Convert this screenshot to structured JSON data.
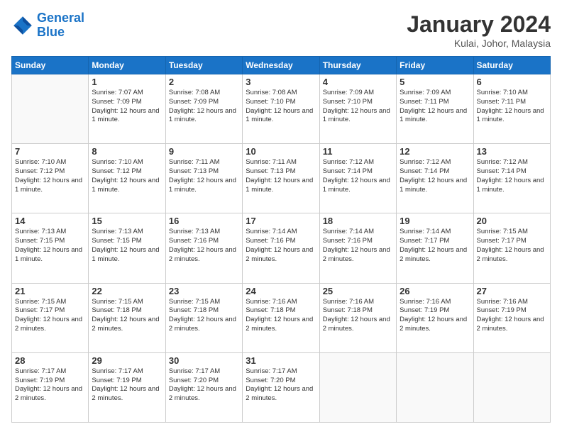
{
  "header": {
    "logo_line1": "General",
    "logo_line2": "Blue",
    "month": "January 2024",
    "location": "Kulai, Johor, Malaysia"
  },
  "weekdays": [
    "Sunday",
    "Monday",
    "Tuesday",
    "Wednesday",
    "Thursday",
    "Friday",
    "Saturday"
  ],
  "weeks": [
    [
      {
        "day": "",
        "sunrise": "",
        "sunset": "",
        "daylight": ""
      },
      {
        "day": "1",
        "sunrise": "7:07 AM",
        "sunset": "7:09 PM",
        "daylight": "12 hours and 1 minute."
      },
      {
        "day": "2",
        "sunrise": "7:08 AM",
        "sunset": "7:09 PM",
        "daylight": "12 hours and 1 minute."
      },
      {
        "day": "3",
        "sunrise": "7:08 AM",
        "sunset": "7:10 PM",
        "daylight": "12 hours and 1 minute."
      },
      {
        "day": "4",
        "sunrise": "7:09 AM",
        "sunset": "7:10 PM",
        "daylight": "12 hours and 1 minute."
      },
      {
        "day": "5",
        "sunrise": "7:09 AM",
        "sunset": "7:11 PM",
        "daylight": "12 hours and 1 minute."
      },
      {
        "day": "6",
        "sunrise": "7:10 AM",
        "sunset": "7:11 PM",
        "daylight": "12 hours and 1 minute."
      }
    ],
    [
      {
        "day": "7",
        "sunrise": "7:10 AM",
        "sunset": "7:12 PM",
        "daylight": "12 hours and 1 minute."
      },
      {
        "day": "8",
        "sunrise": "7:10 AM",
        "sunset": "7:12 PM",
        "daylight": "12 hours and 1 minute."
      },
      {
        "day": "9",
        "sunrise": "7:11 AM",
        "sunset": "7:13 PM",
        "daylight": "12 hours and 1 minute."
      },
      {
        "day": "10",
        "sunrise": "7:11 AM",
        "sunset": "7:13 PM",
        "daylight": "12 hours and 1 minute."
      },
      {
        "day": "11",
        "sunrise": "7:12 AM",
        "sunset": "7:14 PM",
        "daylight": "12 hours and 1 minute."
      },
      {
        "day": "12",
        "sunrise": "7:12 AM",
        "sunset": "7:14 PM",
        "daylight": "12 hours and 1 minute."
      },
      {
        "day": "13",
        "sunrise": "7:12 AM",
        "sunset": "7:14 PM",
        "daylight": "12 hours and 1 minute."
      }
    ],
    [
      {
        "day": "14",
        "sunrise": "7:13 AM",
        "sunset": "7:15 PM",
        "daylight": "12 hours and 1 minute."
      },
      {
        "day": "15",
        "sunrise": "7:13 AM",
        "sunset": "7:15 PM",
        "daylight": "12 hours and 1 minute."
      },
      {
        "day": "16",
        "sunrise": "7:13 AM",
        "sunset": "7:16 PM",
        "daylight": "12 hours and 2 minutes."
      },
      {
        "day": "17",
        "sunrise": "7:14 AM",
        "sunset": "7:16 PM",
        "daylight": "12 hours and 2 minutes."
      },
      {
        "day": "18",
        "sunrise": "7:14 AM",
        "sunset": "7:16 PM",
        "daylight": "12 hours and 2 minutes."
      },
      {
        "day": "19",
        "sunrise": "7:14 AM",
        "sunset": "7:17 PM",
        "daylight": "12 hours and 2 minutes."
      },
      {
        "day": "20",
        "sunrise": "7:15 AM",
        "sunset": "7:17 PM",
        "daylight": "12 hours and 2 minutes."
      }
    ],
    [
      {
        "day": "21",
        "sunrise": "7:15 AM",
        "sunset": "7:17 PM",
        "daylight": "12 hours and 2 minutes."
      },
      {
        "day": "22",
        "sunrise": "7:15 AM",
        "sunset": "7:18 PM",
        "daylight": "12 hours and 2 minutes."
      },
      {
        "day": "23",
        "sunrise": "7:15 AM",
        "sunset": "7:18 PM",
        "daylight": "12 hours and 2 minutes."
      },
      {
        "day": "24",
        "sunrise": "7:16 AM",
        "sunset": "7:18 PM",
        "daylight": "12 hours and 2 minutes."
      },
      {
        "day": "25",
        "sunrise": "7:16 AM",
        "sunset": "7:18 PM",
        "daylight": "12 hours and 2 minutes."
      },
      {
        "day": "26",
        "sunrise": "7:16 AM",
        "sunset": "7:19 PM",
        "daylight": "12 hours and 2 minutes."
      },
      {
        "day": "27",
        "sunrise": "7:16 AM",
        "sunset": "7:19 PM",
        "daylight": "12 hours and 2 minutes."
      }
    ],
    [
      {
        "day": "28",
        "sunrise": "7:17 AM",
        "sunset": "7:19 PM",
        "daylight": "12 hours and 2 minutes."
      },
      {
        "day": "29",
        "sunrise": "7:17 AM",
        "sunset": "7:19 PM",
        "daylight": "12 hours and 2 minutes."
      },
      {
        "day": "30",
        "sunrise": "7:17 AM",
        "sunset": "7:20 PM",
        "daylight": "12 hours and 2 minutes."
      },
      {
        "day": "31",
        "sunrise": "7:17 AM",
        "sunset": "7:20 PM",
        "daylight": "12 hours and 2 minutes."
      },
      {
        "day": "",
        "sunrise": "",
        "sunset": "",
        "daylight": ""
      },
      {
        "day": "",
        "sunrise": "",
        "sunset": "",
        "daylight": ""
      },
      {
        "day": "",
        "sunrise": "",
        "sunset": "",
        "daylight": ""
      }
    ]
  ]
}
